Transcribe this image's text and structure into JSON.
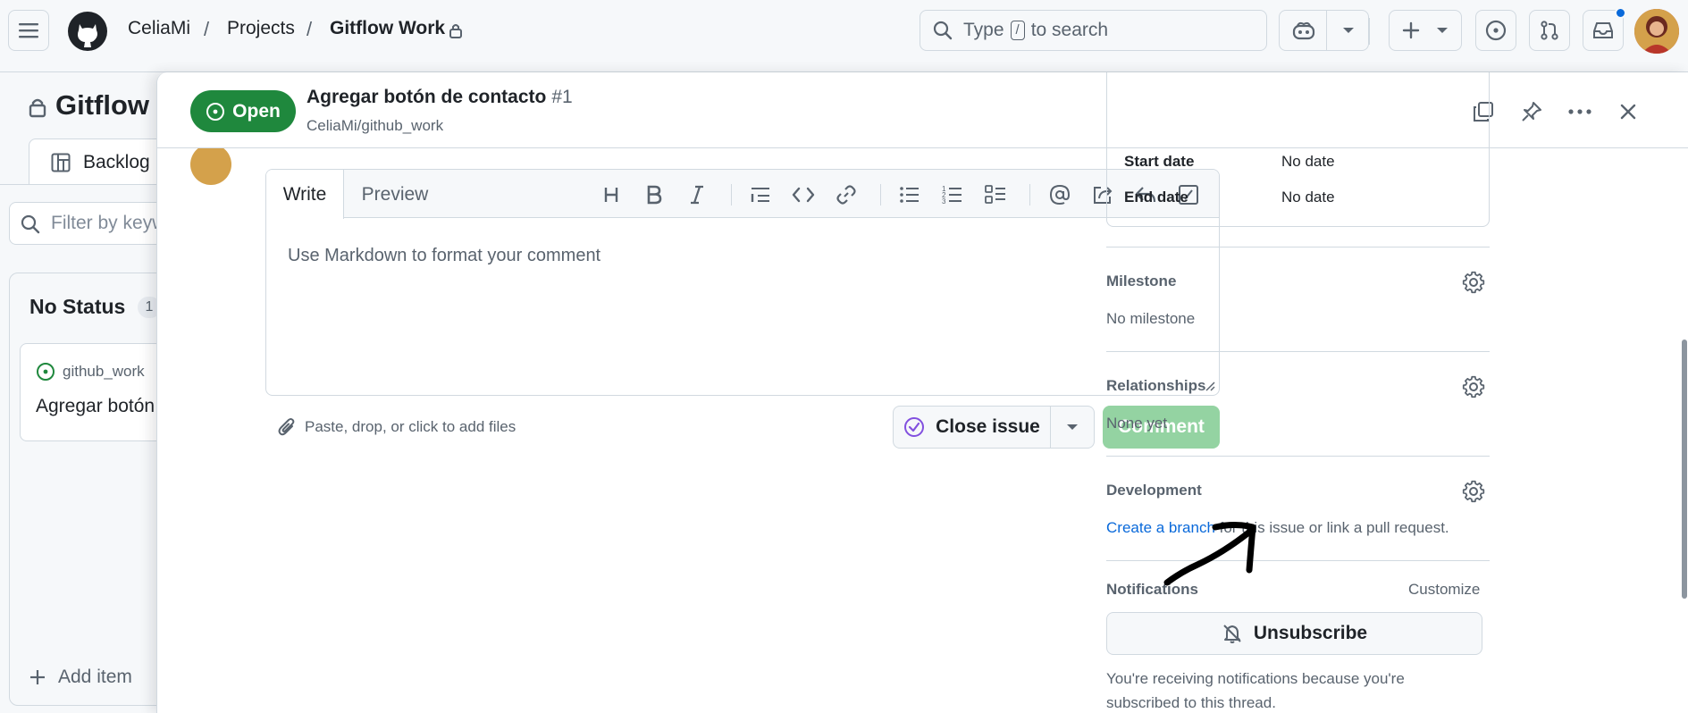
{
  "header": {
    "user": "CeliaMi",
    "projects": "Projects",
    "project_name": "Gitflow Work",
    "search_prefix": "Type",
    "search_key": "/",
    "search_suffix": "to search"
  },
  "board": {
    "title": "Gitflow W",
    "tab_backlog": "Backlog",
    "filter_placeholder": "Filter by keyw",
    "column_title": "No Status",
    "column_count": "1",
    "card_repo": "github_work",
    "card_title": "Agregar botón",
    "add_item": "Add item"
  },
  "issue": {
    "state": "Open",
    "title": "Agregar botón de contacto",
    "number": "#1",
    "repo": "CeliaMi/github_work"
  },
  "editor": {
    "tab_write": "Write",
    "tab_preview": "Preview",
    "placeholder": "Use Markdown to format your comment",
    "attach": "Paste, drop, or click to add files",
    "close_issue": "Close issue",
    "comment": "Comment",
    "tools": [
      "heading-icon",
      "bold-icon",
      "italic-icon",
      "quote-icon",
      "code-icon",
      "link-icon",
      "unordered-list-icon",
      "ordered-list-icon",
      "task-list-icon",
      "mention-icon",
      "reference-icon",
      "saved-reply-icon",
      "slash-command-icon"
    ]
  },
  "sidebar": {
    "start_date_label": "Start date",
    "start_date_value": "No date",
    "end_date_label": "End date",
    "end_date_value": "No date",
    "milestone_title": "Milestone",
    "milestone_value": "No milestone",
    "relationships_title": "Relationships",
    "relationships_value": "None yet",
    "development_title": "Development",
    "development_link": "Create a branch",
    "development_text": " for this issue or link a pull request.",
    "notifications_title": "Notifications",
    "notifications_customize": "Customize",
    "unsubscribe": "Unsubscribe",
    "notice": "You're receiving notifications because you're subscribed to this thread."
  },
  "colors": {
    "open_green": "#1f883d",
    "comment_disabled": "#94d3a2",
    "link_blue": "#0969da",
    "notification_dot": "#0969da"
  }
}
